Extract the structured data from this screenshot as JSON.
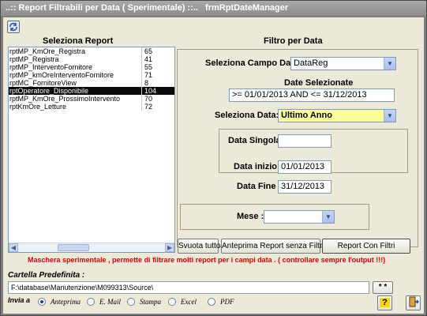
{
  "window": {
    "title": "..:: Report Filtrabili per Data ( Sperimentale) ::..   frmRptDateManager"
  },
  "left": {
    "header": "Seleziona Report",
    "items": [
      {
        "name": "rptMP_KmOre_Registra",
        "id": "65"
      },
      {
        "name": "rptMP_Registra",
        "id": "41"
      },
      {
        "name": "rptMP_InterventoFornitore",
        "id": "55"
      },
      {
        "name": "rptMP_kmOreInterventoFornitore",
        "id": "71"
      },
      {
        "name": "rptMC_FornitoreView",
        "id": "8"
      },
      {
        "name": "rptOperatore_Disponibile",
        "id": "104"
      },
      {
        "name": "rptMP_KmOre_ProssimoIntervento",
        "id": "70"
      },
      {
        "name": "rptKmOre_Letture",
        "id": "72"
      }
    ],
    "selected_index": 5
  },
  "filter": {
    "header": "Filtro per Data",
    "campo_label": "Seleziona Campo Data :",
    "campo_value": "DataReg",
    "date_sel_label": "Date Selezionate",
    "date_sel_value": ">= 01/01/2013 AND <= 31/12/2013",
    "sel_data_label": "Seleziona Data:",
    "sel_data_value": "Ultimo Anno",
    "data_singola_label": "Data Singola:",
    "data_singola_value": "",
    "data_inizio_label": "Data inizio :",
    "data_inizio_value": "01/01/2013",
    "data_fine_label": "Data Fine :",
    "data_fine_value": "31/12/2013",
    "mese_label": "Mese :",
    "mese_value": ""
  },
  "buttons": {
    "svuota": "Svuota tutto",
    "anteprima": "Anteprima Report senza Filtri",
    "report_con_filtri": "Report Con Filtri"
  },
  "warning": "Maschera sperimentale ,  permette di filtrare molti report per i campi data .  ( controllare sempre l'output !!!)",
  "folder": {
    "label": "Cartella Predefinita :",
    "path": "F:\\database\\Manutenzione\\M099313\\Source\\",
    "browse": "* *"
  },
  "send": {
    "label": "Invia a",
    "options": [
      "Anteprima",
      "E. Mail",
      "Stampa",
      "Excel",
      "PDF"
    ],
    "selected": 0
  },
  "colors": {
    "highlight_combo": "#ffff99",
    "warning": "#e00000"
  }
}
